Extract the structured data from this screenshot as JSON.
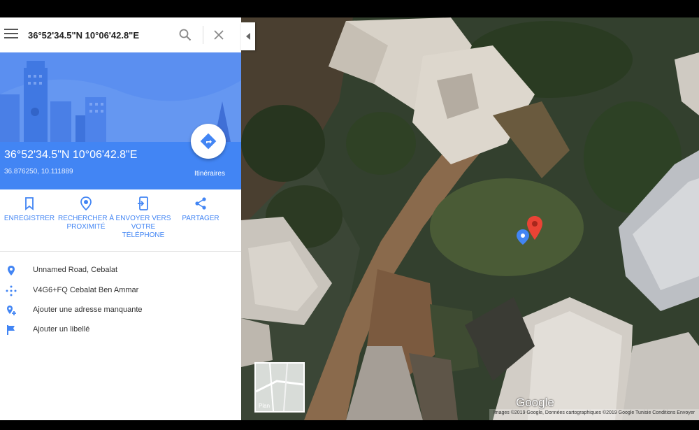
{
  "search": {
    "value": "36°52'34.5\"N 10°06'42.8\"E"
  },
  "place": {
    "title": "36°52'34.5\"N 10°06'42.8\"E",
    "decimal": "36.876250, 10.111889",
    "directions_label": "Itinéraires"
  },
  "actions": [
    {
      "label": "Enregistrer",
      "icon": "bookmark-icon"
    },
    {
      "label": "Rechercher à proximité",
      "icon": "nearby-icon"
    },
    {
      "label": "Envoyer vers votre téléphone",
      "icon": "send-to-phone-icon"
    },
    {
      "label": "Partager",
      "icon": "share-icon"
    }
  ],
  "info": [
    {
      "text": "Unnamed Road, Cebalat",
      "icon": "location-pin-icon"
    },
    {
      "text": "V4G6+FQ Cebalat Ben Ammar",
      "icon": "plus-code-icon"
    },
    {
      "text": "Ajouter une adresse manquante",
      "icon": "add-location-icon"
    },
    {
      "text": "Ajouter un libellé",
      "icon": "flag-icon"
    }
  ],
  "map": {
    "minimap_label": "Plan",
    "logo": "Google",
    "copyright": "Images ©2019 Google, Données cartographiques ©2019 Google   Tunisie   Conditions   Envoyer"
  },
  "colors": {
    "accent": "#4285f4",
    "pin": "#ea4335",
    "hero": "#5b8ff0"
  }
}
